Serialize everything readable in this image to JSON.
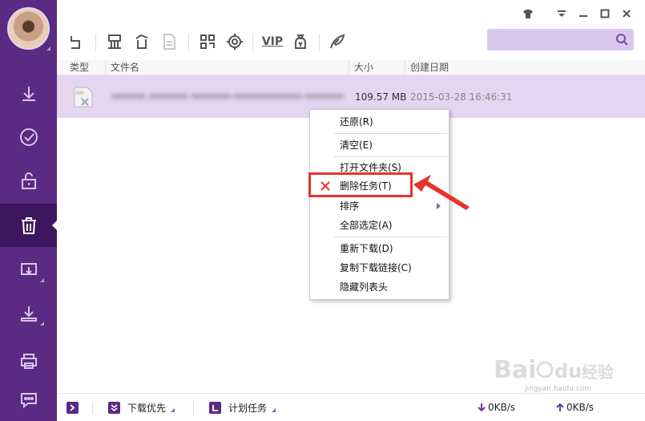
{
  "sidebar": {
    "items": [
      {
        "name": "downloading",
        "icon": "download-arrow-icon"
      },
      {
        "name": "completed",
        "icon": "check-circle-icon"
      },
      {
        "name": "unlocked",
        "icon": "unlock-icon"
      },
      {
        "name": "trash",
        "icon": "trash-icon",
        "active": true
      },
      {
        "name": "upload-task",
        "icon": "monitor-download-icon"
      },
      {
        "name": "download-to",
        "icon": "tray-download-icon"
      },
      {
        "name": "printer",
        "icon": "printer-icon"
      },
      {
        "name": "chat",
        "icon": "chat-bubble-icon"
      }
    ]
  },
  "toolbar": {
    "tools": [
      "restore-icon",
      "clear-icon",
      "delete-icon",
      "file-icon",
      "grid-icon",
      "settings-gear-icon",
      "vip-icon",
      "money-bag-icon",
      "wing-icon"
    ],
    "vip_label": "VIP",
    "search_placeholder": ""
  },
  "columns": {
    "type": "类型",
    "name": "文件名",
    "size": "大小",
    "date": "创建日期"
  },
  "row": {
    "file_type": "RM",
    "file_name": "nnnnnn nnnnnnn nnnnnnn-nnnnnnnnnnnn nnnnnnnnn nnn",
    "size": "109.57 MB",
    "date": "2015-03-28 16:46:31"
  },
  "context_menu": {
    "items": [
      {
        "label": "还原(R)"
      },
      {
        "label": "清空(E)"
      },
      {
        "label": "打开文件夹(S)"
      },
      {
        "label": "删除任务(T)"
      },
      {
        "label": "排序"
      },
      {
        "label": "全部选定(A)"
      },
      {
        "label": "重新下载(D)"
      },
      {
        "label": "复制下载链接(C)"
      },
      {
        "label": "隐藏列表头"
      }
    ]
  },
  "statusbar": {
    "priority_label": "下载优先",
    "schedule_label": "计划任务",
    "download_speed": "0KB/s",
    "upload_speed": "0KB/s"
  },
  "colors": {
    "sidebar": "#5b2a83",
    "row_selected": "#e4d5f0",
    "highlight": "#e8322c"
  },
  "watermark": {
    "text": "Bai du 经验",
    "url": "jingyan.baidu.com"
  }
}
